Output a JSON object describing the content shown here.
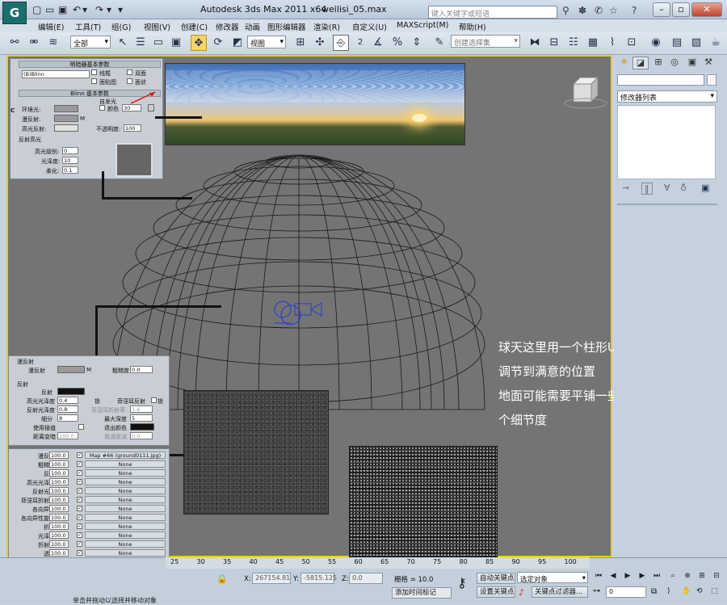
{
  "app": {
    "window_title": "Autodesk 3ds Max  2011 x64",
    "file_name": "weilisi_05.max",
    "search_placeholder": "键入关键字或短语",
    "logo": "G",
    "help_symbol": "?"
  },
  "menu": [
    "编辑(E)",
    "工具(T)",
    "组(G)",
    "视图(V)",
    "创建(C)",
    "修改器",
    "动画",
    "图形编辑器",
    "渲染(R)",
    "自定义(U)",
    "MAXScript(M)",
    "帮助(H)"
  ],
  "toolbar": {
    "selection_filter": "全部",
    "ref_coord": "视图",
    "named_selection": "创建选择集",
    "snap_number": "2",
    "snap_number2": "3"
  },
  "right_panel": {
    "modifier_list": "修改器列表"
  },
  "material_editor": {
    "shader_header": "明暗器基本参数",
    "shader_type": "(B)Blinn",
    "shader_options": [
      "线框",
      "双面",
      "面贴图",
      "面状"
    ],
    "blinn_header": "Blinn 基本参数",
    "self_illum": "自发光",
    "color_label": "颜色",
    "color_value": "30",
    "ambient": "环境光:",
    "diffuse": "漫反射:",
    "specular": "高光反射:",
    "opacity": "不透明度:",
    "opacity_value": "100",
    "spec_hl_group": "反射高光",
    "spec_level": "高光级别:",
    "spec_level_value": "0",
    "glossiness": "光泽度:",
    "glossiness_value": "10",
    "soften": "柔化:",
    "soften_value": "0.1",
    "lock_c": "C",
    "lock_m": "M"
  },
  "vray_material": {
    "diffuse_group": "漫反射",
    "diffuse": "漫反射",
    "roughness": "粗糙度",
    "roughness_value": "0.0",
    "m": "M",
    "reflect_group": "反射",
    "reflect": "反射",
    "hl_gloss": "高光光泽度",
    "hl_gloss_value": "0.4",
    "refl_gloss": "反射光泽度",
    "refl_gloss_value": "0.8",
    "subdivs": "细分",
    "subdivs_value": "8",
    "use_interp": "使用插值",
    "dist_dim": "距离变暗",
    "dist_dim_value": "100.0",
    "fresnel": "菲涅耳反射",
    "fresnel_ior": "菲涅耳折射率",
    "fresnel_ior_value": "1.6",
    "max_depth": "最大深度",
    "max_depth_value": "5",
    "exit_color": "退出颜色",
    "dim_falloff": "衰减衰减",
    "dim_falloff_value": "0.0",
    "lock": "锁"
  },
  "maps": [
    {
      "name": "漫反射",
      "value": "100.0",
      "map": "Map #66 (ground0111.jpg)"
    },
    {
      "name": "粗糙度",
      "value": "100.0",
      "map": "None"
    },
    {
      "name": "反射",
      "value": "100.0",
      "map": "None"
    },
    {
      "name": "高光光泽度",
      "value": "100.0",
      "map": "None"
    },
    {
      "name": "反射光泽",
      "value": "100.0",
      "map": "None"
    },
    {
      "name": "菲涅耳折射率",
      "value": "100.0",
      "map": "None"
    },
    {
      "name": "各向异性",
      "value": "100.0",
      "map": "None"
    },
    {
      "name": "各向异性旋转",
      "value": "100.0",
      "map": "None"
    },
    {
      "name": "折射",
      "value": "100.0",
      "map": "None"
    },
    {
      "name": "光泽度",
      "value": "100.0",
      "map": "None"
    },
    {
      "name": "折射率",
      "value": "100.0",
      "map": "None"
    },
    {
      "name": "透明",
      "value": "100.0",
      "map": "None"
    },
    {
      "name": "凹凸",
      "value": "1.0",
      "map": "Map #64 (ground01s.jpg)"
    },
    {
      "name": "置换",
      "value": "100.0",
      "map": "None"
    },
    {
      "name": "不透明度",
      "value": "100.0",
      "map": "None"
    },
    {
      "name": "环境",
      "value": "",
      "map": "None"
    }
  ],
  "annotation": [
    "球天这里用一个柱形UV然后进行",
    "调节到满意的位置",
    "地面可能需要平铺一些以达到一",
    "个细节度"
  ],
  "status": {
    "time_ticks": [
      "25",
      "30",
      "35",
      "40",
      "45",
      "50",
      "55",
      "60",
      "65",
      "70",
      "75",
      "80",
      "85",
      "90",
      "95",
      "100"
    ],
    "x_label": "X:",
    "x_value": "267154.81",
    "y_label": "Y:",
    "y_value": "-5815.125",
    "z_label": "Z:",
    "z_value": "0.0",
    "grid": "栅格 = 10.0",
    "add_time_tag": "添加时间标记",
    "auto_key": "自动关键点",
    "set_key": "设置关键点",
    "selected_object": "选定对象",
    "key_filter": "关键点过滤器...",
    "frame": "0",
    "bottom_text": "单击并拖动以选择并移动对象"
  },
  "colors": {
    "viewport_bg": "#747474",
    "active_border": "#e8d200",
    "wire": "#1a1a1a",
    "camera": "#1f3bd6"
  }
}
